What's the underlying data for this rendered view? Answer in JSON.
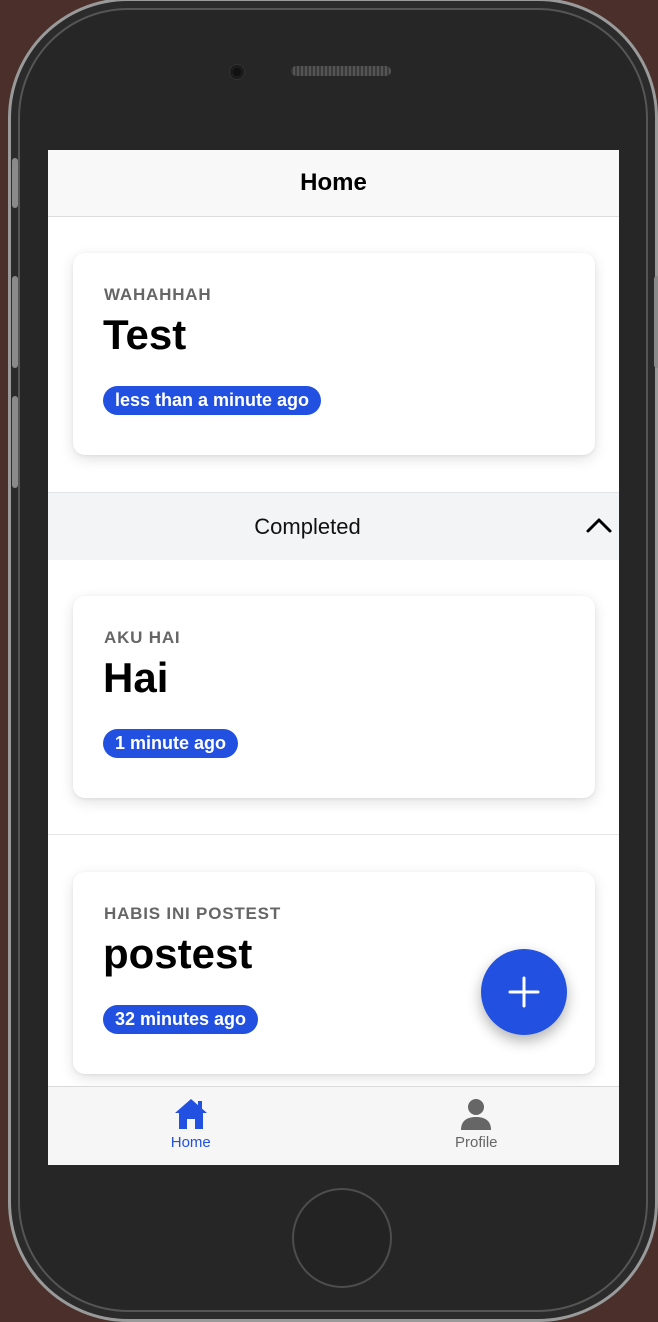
{
  "header": {
    "title": "Home"
  },
  "pending_tasks": [
    {
      "subtitle": "WAHAHHAH",
      "title": "Test",
      "time": "less than a minute ago"
    }
  ],
  "completed_section": {
    "label": "Completed",
    "icon": "chevron-up-icon",
    "expanded": true
  },
  "completed_tasks": [
    {
      "subtitle": "AKU HAI",
      "title": "Hai",
      "time": "1 minute ago"
    },
    {
      "subtitle": "HABIS INI POSTEST",
      "title": "postest",
      "time": "32 minutes ago"
    }
  ],
  "fab": {
    "icon": "plus-icon"
  },
  "tabbar": {
    "items": [
      {
        "label": "Home",
        "icon": "home-icon",
        "active": true
      },
      {
        "label": "Profile",
        "icon": "person-icon",
        "active": false
      }
    ]
  },
  "colors": {
    "accent": "#2250e0",
    "badge_text": "#ffffff",
    "section_bg": "#f3f4f6"
  }
}
